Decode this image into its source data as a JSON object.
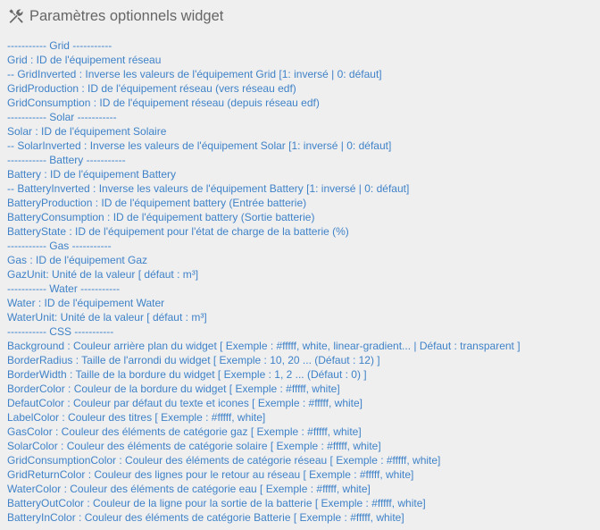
{
  "header": {
    "icon": "wrench-screwdriver-icon",
    "title": "Paramètres optionnels widget"
  },
  "colors": {
    "background": "#efefef",
    "title": "#666666",
    "text": "#3f82c8"
  },
  "lines": [
    "----------- Grid -----------",
    "Grid : ID de l'équipement réseau",
    "-- GridInverted : Inverse les valeurs de l'équipement Grid [1: inversé | 0: défaut]",
    "GridProduction : ID de l'équipement réseau (vers réseau edf)",
    "GridConsumption : ID de l'équipement réseau (depuis réseau edf)",
    "----------- Solar -----------",
    "Solar : ID de l'équipement Solaire",
    "-- SolarInverted : Inverse les valeurs de l'équipement Solar [1: inversé | 0: défaut]",
    "----------- Battery -----------",
    "Battery : ID de l'équipement Battery",
    "-- BatteryInverted : Inverse les valeurs de l'équipement Battery [1: inversé | 0: défaut]",
    "BatteryProduction : ID de l'équipement battery (Entrée batterie)",
    "BatteryConsumption : ID de l'équipement battery (Sortie batterie)",
    "BatteryState : ID de l'équipement pour l'état de charge de la batterie (%)",
    "----------- Gas -----------",
    "Gas : ID de l'équipement Gaz",
    "GazUnit: Unité de la valeur [ défaut : m³]",
    "----------- Water -----------",
    "Water : ID de l'équipement Water",
    "WaterUnit: Unité de la valeur [ défaut : m³]",
    "----------- CSS -----------",
    "Background : Couleur arrière plan du widget [ Exemple : #fffff, white, linear-gradient... | Défaut : transparent ]",
    "BorderRadius : Taille de l'arrondi du widget [ Exemple : 10, 20 ... (Défaut : 12) ]",
    "BorderWidth : Taille de la bordure du widget [ Exemple : 1, 2 ... (Défaut : 0) ]",
    "BorderColor : Couleur de la bordure du widget [ Exemple : #fffff, white]",
    "DefautColor : Couleur par défaut du texte et icones [ Exemple : #fffff, white]",
    "LabelColor : Couleur des titres [ Exemple : #fffff, white]",
    "GasColor : Couleur des éléments de catégorie gaz [ Exemple : #fffff, white]",
    "SolarColor : Couleur des éléments de catégorie solaire [ Exemple : #fffff, white]",
    "GridConsumptionColor : Couleur des éléments de catégorie réseau [ Exemple : #fffff, white]",
    "GridReturnColor : Couleur des lignes pour le retour au réseau [ Exemple : #fffff, white]",
    "WaterColor : Couleur des éléments de catégorie eau [ Exemple : #fffff, white]",
    "BatteryOutColor : Couleur de la ligne pour la sortie de la batterie [ Exemple : #fffff, white]",
    "BatteryInColor : Couleur des éléments de catégorie Batterie [ Exemple : #fffff, white]"
  ]
}
